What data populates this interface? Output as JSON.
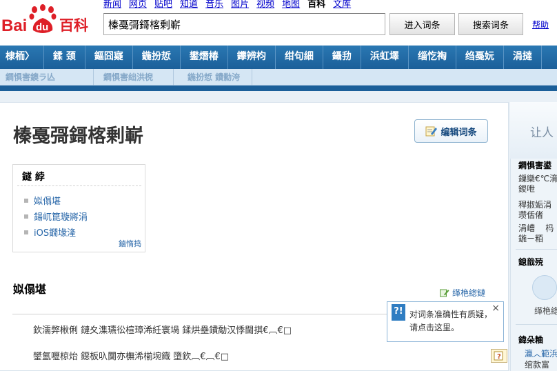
{
  "header": {
    "logo_text_bai": "Bai",
    "logo_text_du": "du",
    "logo_text_baike": "百科",
    "topnav": [
      {
        "label": "新闻"
      },
      {
        "label": "网页"
      },
      {
        "label": "贴吧"
      },
      {
        "label": "知道"
      },
      {
        "label": "音乐"
      },
      {
        "label": "图片"
      },
      {
        "label": "视频"
      },
      {
        "label": "地图"
      },
      {
        "label": "百科"
      },
      {
        "label": "文库"
      }
    ],
    "search_value": "榛戞彁鎶楁剰嶄",
    "enter_button": "进入词条",
    "search_button": "搜索词条",
    "help_link": "帮助"
  },
  "mainnav": [
    {
      "label": "棣栭〉"
    },
    {
      "label": "鍒 颈"
    },
    {
      "label": "鏂囧寲"
    },
    {
      "label": "鍦扮悊"
    },
    {
      "label": "鐢熸椿"
    },
    {
      "label": "鑻辨枃"
    },
    {
      "label": "绀句細"
    },
    {
      "label": "鑷劧"
    },
    {
      "label": "浜虹墿"
    },
    {
      "label": "缁忔祹"
    },
    {
      "label": "绉戞妧"
    },
    {
      "label": "涓撻"
    }
  ],
  "subnav": [
    {
      "label": "鐧惧害鐭ラ亾"
    },
    {
      "label": "鐧惧害绌洪棿"
    },
    {
      "label": "鍦扮悊 鐨勬洿"
    }
  ],
  "lemma": {
    "title": "榛戞彁鎶楁剰嶄",
    "edit_button": "编辑词条"
  },
  "toc": {
    "title": "鐩  綍",
    "items": [
      {
        "label": "姒傝堪"
      },
      {
        "label": "鍚屼箟璇嶈涓"
      },
      {
        "label": "iOS鐗堟湰"
      }
    ],
    "collapse": "鏀惰捣"
  },
  "section": {
    "title": "姒傝堪",
    "edit_link": "缂栬緫鏈",
    "paragraphs": [
      "欽濡弊楸俐    鏈夊潗瓙彸楦璋浠紝寰堝    鍒烘壘鐨勪汉悸閫掑€︹€□",
      "鐢氳嚦椋炲    鐚板叺闅亦橅浠椾埦鐡    墮欽︹€︹€□"
    ]
  },
  "tooltip": {
    "icon": "?!",
    "text": "对词条准确性有质疑，请点击这里。",
    "close": "×"
  },
  "sidebar": {
    "head_text": "让人",
    "block1_title": "鐧惧害鍙",
    "block1_items": [
      "鏁欒€℃湇\n鍐呭",
      "稈掓姤涓\n瓒佸偖",
      "涓嶆    杩\n鍦ㄧ粨"
    ],
    "block2_title": "鎴戠殑",
    "circle_label": "缂栬緫",
    "block3_title": "鍏朵粬",
    "block3_items": [
      "瀛︿範浜",
      "绾款富"
    ]
  }
}
